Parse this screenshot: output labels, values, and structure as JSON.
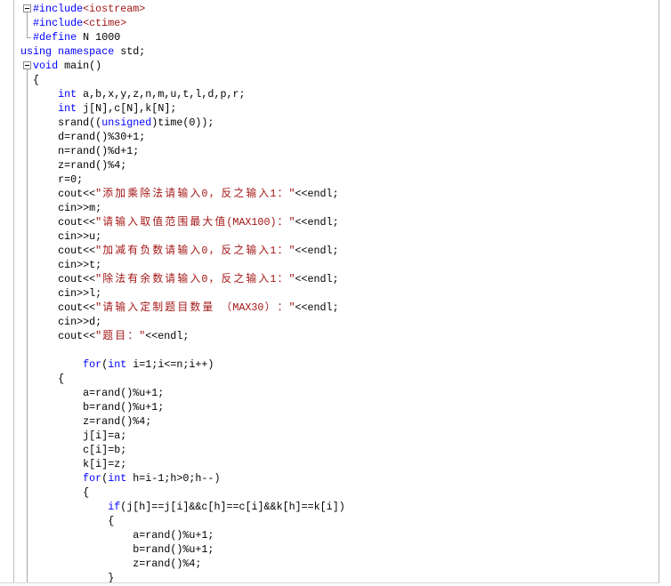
{
  "editor": {
    "lines": [
      {
        "gutter": "collapse-box-icon",
        "tokens": [
          {
            "t": "  "
          },
          {
            "t": "#include",
            "c": "#0000ff"
          },
          {
            "t": "<iostream>",
            "c": "#a31515"
          }
        ]
      },
      {
        "gutter": "fold-line-icon",
        "tokens": [
          {
            "t": "  "
          },
          {
            "t": "#include",
            "c": "#0000ff"
          },
          {
            "t": "<ctime>",
            "c": "#a31515"
          }
        ]
      },
      {
        "gutter": "fold-end-icon",
        "tokens": [
          {
            "t": "  "
          },
          {
            "t": "#define",
            "c": "#0000ff"
          },
          {
            "t": " N 1000"
          }
        ]
      },
      {
        "tokens": [
          {
            "t": "using",
            "c": "#0000ff"
          },
          {
            "t": " "
          },
          {
            "t": "namespace",
            "c": "#0000ff"
          },
          {
            "t": " std;"
          }
        ]
      },
      {
        "gutter": "collapse-box-icon",
        "tokens": [
          {
            "t": "  "
          },
          {
            "t": "void",
            "c": "#0000ff"
          },
          {
            "t": " main()"
          }
        ]
      },
      {
        "gutter": "fold-line-icon",
        "tokens": [
          {
            "t": "  {"
          }
        ]
      },
      {
        "gutter": "fold-line-icon",
        "tokens": [
          {
            "t": "      "
          },
          {
            "t": "int",
            "c": "#0000ff"
          },
          {
            "t": " a,b,x,y,z,n,m,u,t,l,d,p,r;"
          }
        ]
      },
      {
        "gutter": "fold-line-icon",
        "tokens": [
          {
            "t": "      "
          },
          {
            "t": "int",
            "c": "#0000ff"
          },
          {
            "t": " j[N],c[N],k[N];"
          }
        ]
      },
      {
        "gutter": "fold-line-icon",
        "tokens": [
          {
            "t": "      srand(("
          },
          {
            "t": "unsigned",
            "c": "#0000ff"
          },
          {
            "t": ")time(0));"
          }
        ]
      },
      {
        "gutter": "fold-line-icon",
        "tokens": [
          {
            "t": "      d=rand()%30+1;"
          }
        ]
      },
      {
        "gutter": "fold-line-icon",
        "tokens": [
          {
            "t": "      n=rand()%d+1;"
          }
        ]
      },
      {
        "gutter": "fold-line-icon",
        "tokens": [
          {
            "t": "      z=rand()%4;"
          }
        ]
      },
      {
        "gutter": "fold-line-icon",
        "tokens": [
          {
            "t": "      r=0;"
          }
        ]
      },
      {
        "gutter": "fold-line-icon",
        "tokens": [
          {
            "t": "      cout<<"
          },
          {
            "t": "\"添加乘除法请输入0，反之输入1：\"",
            "c": "#a31515"
          },
          {
            "t": "<<endl;"
          }
        ]
      },
      {
        "gutter": "fold-line-icon",
        "tokens": [
          {
            "t": "      cin>>m;"
          }
        ]
      },
      {
        "gutter": "fold-line-icon",
        "tokens": [
          {
            "t": "      cout<<"
          },
          {
            "t": "\"请输入取值范围最大值(MAX100)：\"",
            "c": "#a31515"
          },
          {
            "t": "<<endl;"
          }
        ]
      },
      {
        "gutter": "fold-line-icon",
        "tokens": [
          {
            "t": "      cin>>u;"
          }
        ]
      },
      {
        "gutter": "fold-line-icon",
        "tokens": [
          {
            "t": "      cout<<"
          },
          {
            "t": "\"加减有负数请输入0，反之输入1：\"",
            "c": "#a31515"
          },
          {
            "t": "<<endl;"
          }
        ]
      },
      {
        "gutter": "fold-line-icon",
        "tokens": [
          {
            "t": "      cin>>t;"
          }
        ]
      },
      {
        "gutter": "fold-line-icon",
        "tokens": [
          {
            "t": "      cout<<"
          },
          {
            "t": "\"除法有余数请输入0，反之输入1：\"",
            "c": "#a31515"
          },
          {
            "t": "<<endl;"
          }
        ]
      },
      {
        "gutter": "fold-line-icon",
        "tokens": [
          {
            "t": "      cin>>l;"
          }
        ]
      },
      {
        "gutter": "fold-line-icon",
        "tokens": [
          {
            "t": "      cout<<"
          },
          {
            "t": "\"请输入定制题目数量 （MAX30）：\"",
            "c": "#a31515"
          },
          {
            "t": "<<endl;"
          }
        ]
      },
      {
        "gutter": "fold-line-icon",
        "tokens": [
          {
            "t": "      cin>>d;"
          }
        ]
      },
      {
        "gutter": "fold-line-icon",
        "tokens": [
          {
            "t": "      cout<<"
          },
          {
            "t": "\"题目：\"",
            "c": "#a31515"
          },
          {
            "t": "<<endl;"
          }
        ]
      },
      {
        "gutter": "fold-line-icon",
        "tokens": []
      },
      {
        "gutter": "fold-line-icon",
        "tokens": [
          {
            "t": "          "
          },
          {
            "t": "for",
            "c": "#0000ff"
          },
          {
            "t": "("
          },
          {
            "t": "int",
            "c": "#0000ff"
          },
          {
            "t": " i=1;i<=n;i++)"
          }
        ]
      },
      {
        "gutter": "fold-line-icon",
        "tokens": [
          {
            "t": "      {"
          }
        ]
      },
      {
        "gutter": "fold-line-icon",
        "tokens": [
          {
            "t": "          a=rand()%u+1;"
          }
        ]
      },
      {
        "gutter": "fold-line-icon",
        "tokens": [
          {
            "t": "          b=rand()%u+1;"
          }
        ]
      },
      {
        "gutter": "fold-line-icon",
        "tokens": [
          {
            "t": "          z=rand()%4;"
          }
        ]
      },
      {
        "gutter": "fold-line-icon",
        "tokens": [
          {
            "t": "          j[i]=a;"
          }
        ]
      },
      {
        "gutter": "fold-line-icon",
        "tokens": [
          {
            "t": "          c[i]=b;"
          }
        ]
      },
      {
        "gutter": "fold-line-icon",
        "tokens": [
          {
            "t": "          k[i]=z;"
          }
        ]
      },
      {
        "gutter": "fold-line-icon",
        "tokens": [
          {
            "t": "          "
          },
          {
            "t": "for",
            "c": "#0000ff"
          },
          {
            "t": "("
          },
          {
            "t": "int",
            "c": "#0000ff"
          },
          {
            "t": " h=i-1;h>0;h--)"
          }
        ]
      },
      {
        "gutter": "fold-line-icon",
        "tokens": [
          {
            "t": "          {"
          }
        ]
      },
      {
        "gutter": "fold-line-icon",
        "tokens": [
          {
            "t": "              "
          },
          {
            "t": "if",
            "c": "#0000ff"
          },
          {
            "t": "(j[h]==j[i]&&c[h]==c[i]&&k[h]==k[i])"
          }
        ]
      },
      {
        "gutter": "fold-line-icon",
        "tokens": [
          {
            "t": "              {"
          }
        ]
      },
      {
        "gutter": "fold-line-icon",
        "tokens": [
          {
            "t": "                  a=rand()%u+1;"
          }
        ]
      },
      {
        "gutter": "fold-line-icon",
        "tokens": [
          {
            "t": "                  b=rand()%u+1;"
          }
        ]
      },
      {
        "gutter": "fold-line-icon",
        "tokens": [
          {
            "t": "                  z=rand()%4;"
          }
        ]
      },
      {
        "gutter": "fold-line-icon",
        "tokens": [
          {
            "t": "              }"
          }
        ]
      }
    ]
  }
}
